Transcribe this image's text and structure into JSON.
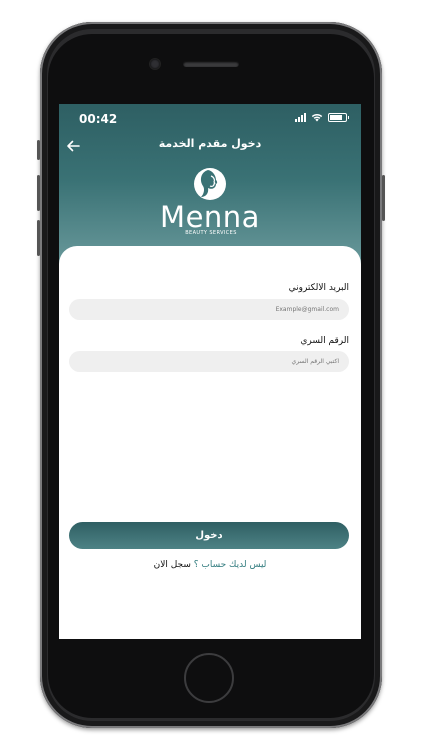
{
  "status_bar": {
    "time": "00:42"
  },
  "header": {
    "title": "دخول مقدم الخدمة",
    "logo_text": "Menna",
    "logo_subtitle": "BEAUTY SERVICES"
  },
  "form": {
    "email_label": "البريد الالكتروني",
    "email_placeholder": "Example@gmail.com",
    "password_label": "الرقم السري",
    "password_placeholder": "اكتبي الرقم السري",
    "login_label": "دخول",
    "no_account_text": "ليس لديك حساب ؟",
    "signup_link": "سجل الان"
  },
  "colors": {
    "primary": "#2f5f63",
    "header_gradient_end": "#6e9d9f",
    "link_teal": "#2f7a7d"
  },
  "icons": {
    "back": "back-arrow-icon",
    "logo": "woman-silhouette-icon",
    "signal": "signal-icon",
    "wifi": "wifi-icon",
    "battery": "battery-icon"
  }
}
